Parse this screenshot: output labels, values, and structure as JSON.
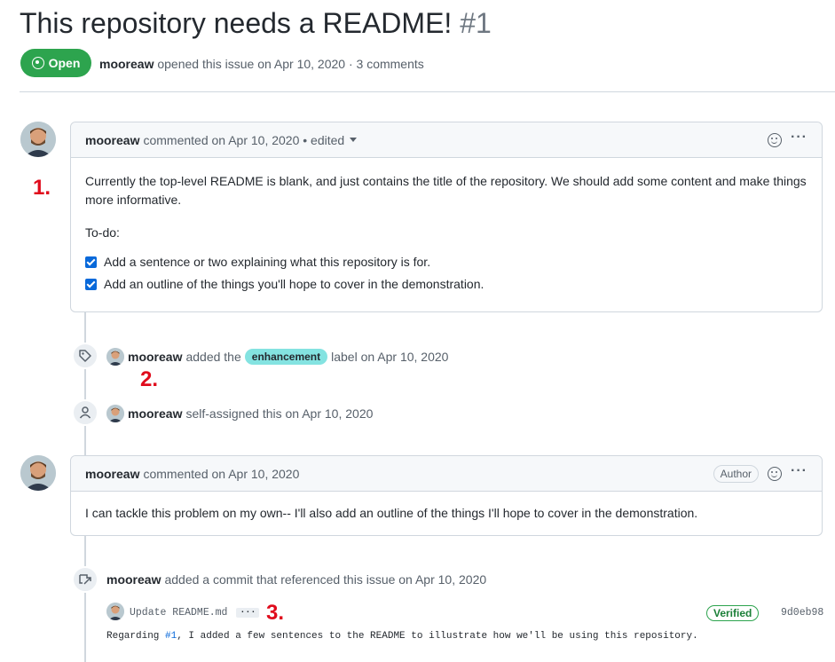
{
  "issue": {
    "title": "This repository needs a README!",
    "number": "#1",
    "state": "Open",
    "state_color": "#2da44e",
    "author": "mooreaw",
    "meta_text": "opened this issue on Apr 10, 2020 · 3 comments"
  },
  "comment1": {
    "author": "mooreaw",
    "meta": "commented on Apr 10, 2020 • edited",
    "paragraph": "Currently the top-level README is blank, and just contains the title of the repository. We should add some content and make things more informative.",
    "todo_heading": "To-do:",
    "tasks": [
      {
        "label": "Add a sentence or two explaining what this repository is for.",
        "checked": true
      },
      {
        "label": "Add an outline of the things you'll hope to cover in the demonstration.",
        "checked": true
      }
    ],
    "icons": {
      "reaction": "smiley-icon",
      "more": "kebab-icon"
    }
  },
  "event_label": {
    "icon": "tag-icon",
    "author": "mooreaw",
    "pre": "added the",
    "label": "enhancement",
    "label_color": "#84e3e1",
    "post": "label on Apr 10, 2020"
  },
  "event_assign": {
    "icon": "person-icon",
    "author": "mooreaw",
    "text": "self-assigned this on Apr 10, 2020"
  },
  "comment2": {
    "author": "mooreaw",
    "meta": "commented on Apr 10, 2020",
    "badge": "Author",
    "body": "I can tackle this problem on my own-- I'll also add an outline of the things I'll hope to cover in the demonstration."
  },
  "event_commit": {
    "icon": "cross-reference-icon",
    "author": "mooreaw",
    "text": "added a commit that referenced this issue on Apr 10, 2020",
    "commit_title": "Update README.md",
    "ellipsis": "···",
    "verified": "Verified",
    "sha": "9d0eb98",
    "message_pre": "Regarding ",
    "message_link": "#1",
    "message_post": ", I added a few sentences to the README to illustrate how we'll be using this repository."
  },
  "markers": [
    "1.",
    "2.",
    "3."
  ]
}
